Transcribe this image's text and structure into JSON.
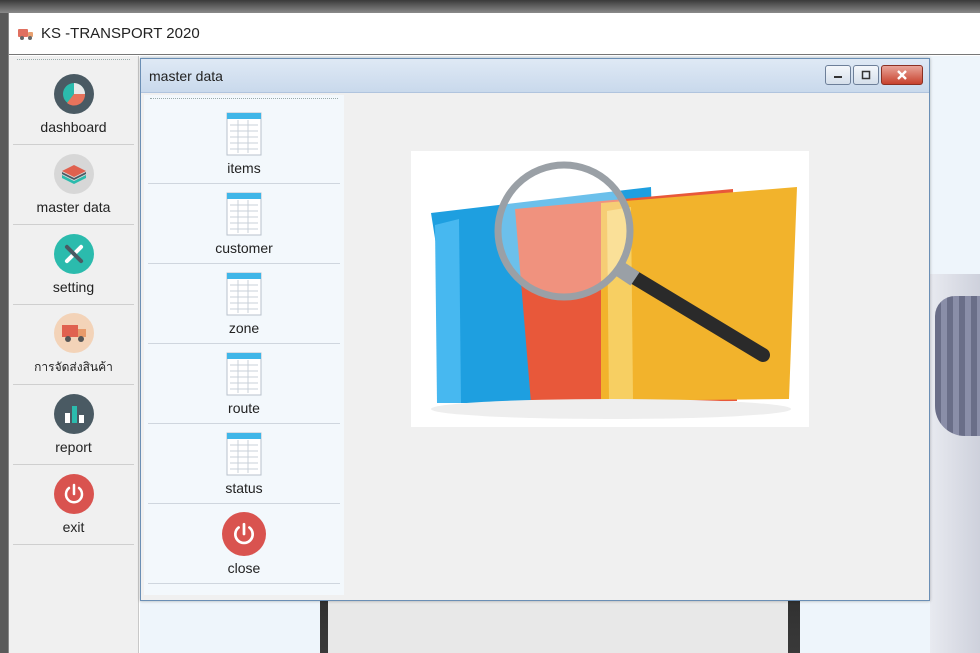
{
  "window": {
    "title": "KS -TRANSPORT 2020"
  },
  "sidebar": {
    "items": [
      {
        "label": "dashboard",
        "icon": "pie-chart-icon"
      },
      {
        "label": "master data",
        "icon": "layers-icon"
      },
      {
        "label": "setting",
        "icon": "tools-icon"
      },
      {
        "label": "การจัดส่งสินค้า",
        "icon": "truck-icon"
      },
      {
        "label": "report",
        "icon": "bar-chart-icon"
      },
      {
        "label": "exit",
        "icon": "power-icon"
      }
    ]
  },
  "child_window": {
    "title": "master data",
    "menu": [
      {
        "label": "items",
        "icon": "document-icon"
      },
      {
        "label": "customer",
        "icon": "document-icon"
      },
      {
        "label": "zone",
        "icon": "document-icon"
      },
      {
        "label": "route",
        "icon": "document-icon"
      },
      {
        "label": "status",
        "icon": "document-icon"
      },
      {
        "label": "close",
        "icon": "power-icon"
      }
    ]
  },
  "colors": {
    "title_gradient": "#c9d9ec",
    "exit_red": "#d9534f",
    "accent_teal": "#2bbbad"
  }
}
